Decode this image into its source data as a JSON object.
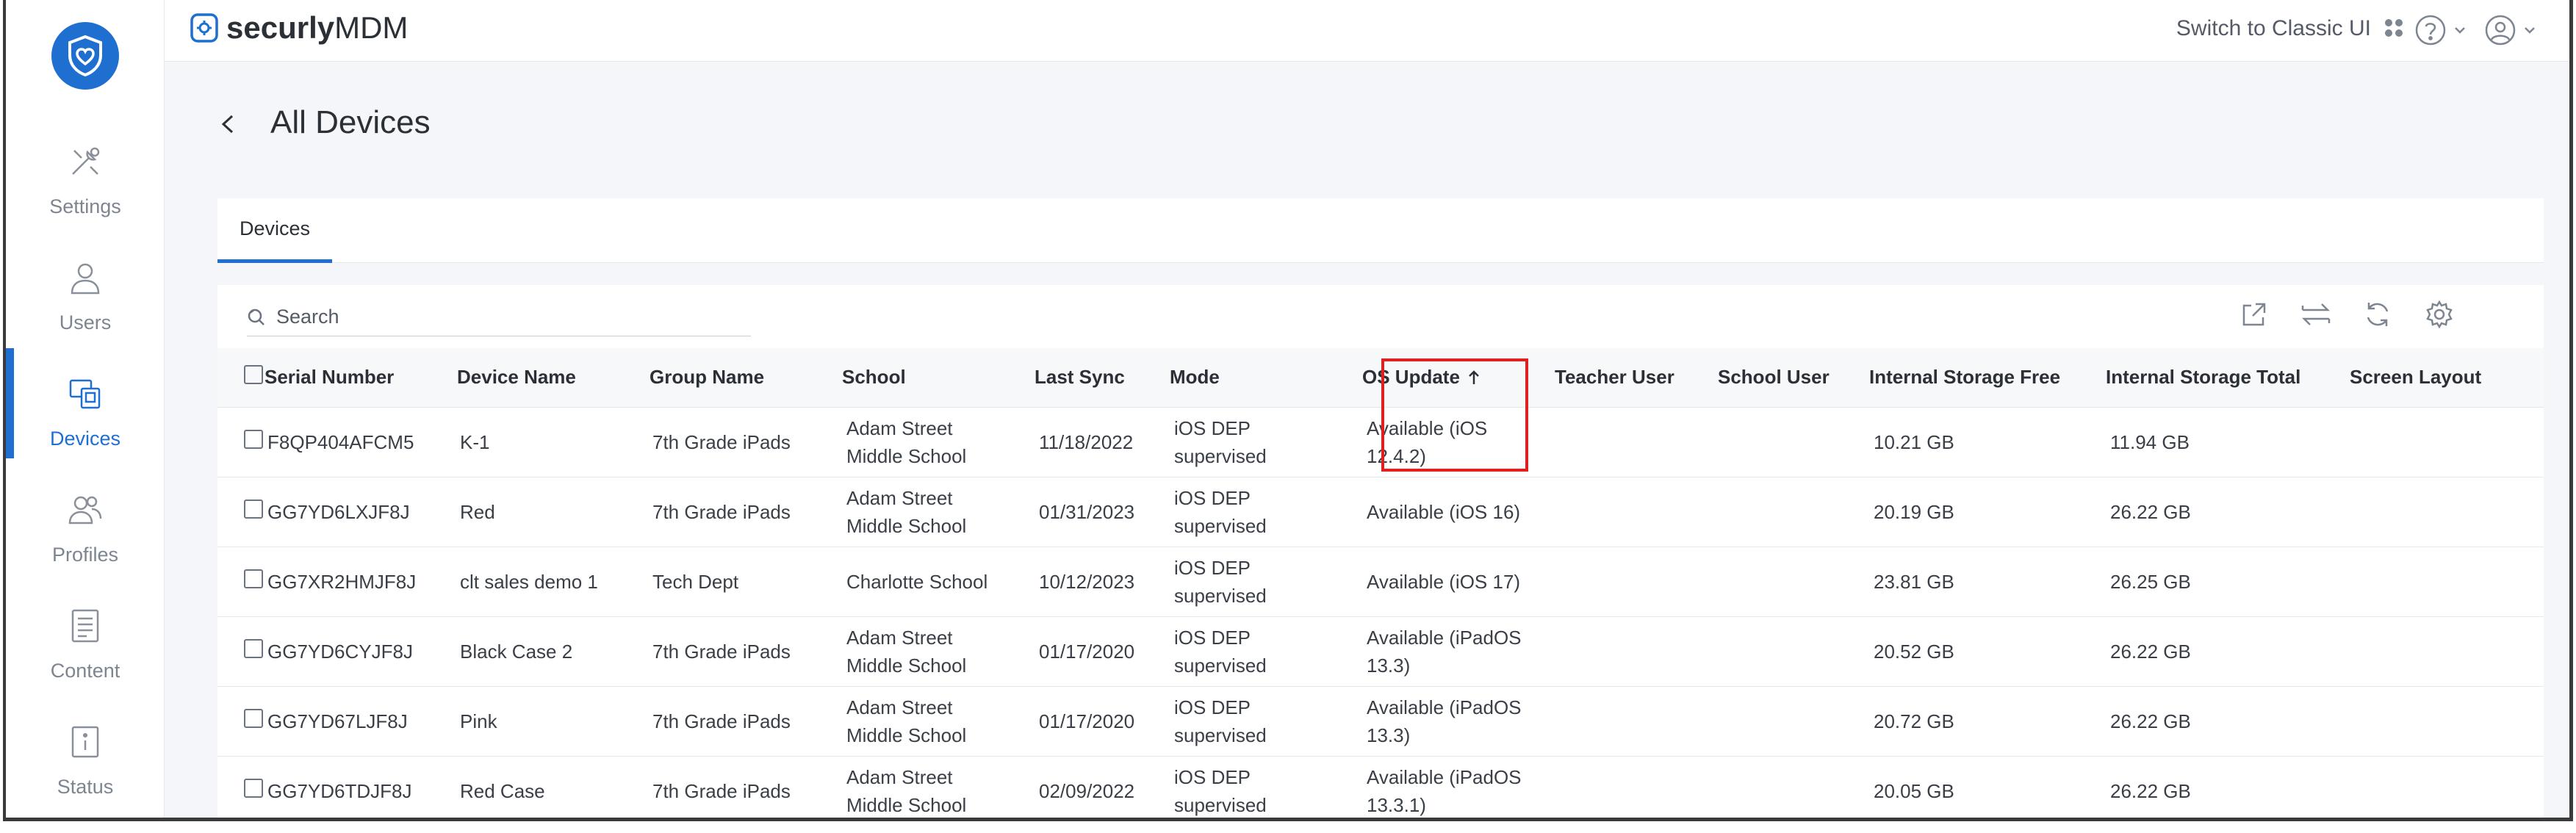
{
  "app": {
    "brand_prefix": "securly",
    "brand_suffix": "MDM"
  },
  "topbar": {
    "classic_link": "Switch to Classic UI"
  },
  "sidebar": {
    "items": [
      {
        "label": "Settings",
        "icon": "tools-icon"
      },
      {
        "label": "Users",
        "icon": "user-icon"
      },
      {
        "label": "Devices",
        "icon": "devices-icon",
        "active": true
      },
      {
        "label": "Profiles",
        "icon": "profiles-icon"
      },
      {
        "label": "Content",
        "icon": "content-icon"
      },
      {
        "label": "Status",
        "icon": "status-icon"
      }
    ]
  },
  "page": {
    "title": "All Devices"
  },
  "tabs": [
    {
      "label": "Devices"
    }
  ],
  "search": {
    "placeholder": "Search"
  },
  "table": {
    "columns": [
      "Serial Number",
      "Device Name",
      "Group Name",
      "School",
      "Last Sync",
      "Mode",
      "OS Update",
      "Teacher User",
      "School User",
      "Internal Storage Free",
      "Internal Storage Total",
      "Screen Layout"
    ],
    "sorted_column": "OS Update",
    "sort_direction": "ascending",
    "rows": [
      {
        "serial": "F8QP404AFCM5",
        "name": "K-1",
        "group": "7th Grade iPads",
        "school_l1": "Adam Street",
        "school_l2": "Middle School",
        "sync": "11/18/2022",
        "mode_l1": "iOS DEP",
        "mode_l2": "supervised",
        "os_l1": "Available (iOS",
        "os_l2": "12.4.2)",
        "teacher": "",
        "school_user": "",
        "free": "10.21 GB",
        "total": "11.94 GB",
        "layout": ""
      },
      {
        "serial": "GG7YD6LXJF8J",
        "name": "Red",
        "group": "7th Grade iPads",
        "school_l1": "Adam Street",
        "school_l2": "Middle School",
        "sync": "01/31/2023",
        "mode_l1": "iOS DEP",
        "mode_l2": "supervised",
        "os_l1": "Available (iOS 16)",
        "os_l2": "",
        "teacher": "",
        "school_user": "",
        "free": "20.19 GB",
        "total": "26.22 GB",
        "layout": ""
      },
      {
        "serial": "GG7XR2HMJF8J",
        "name": "clt sales demo 1",
        "group": "Tech Dept",
        "school_l1": "Charlotte School",
        "school_l2": "",
        "sync": "10/12/2023",
        "mode_l1": "iOS DEP",
        "mode_l2": "supervised",
        "os_l1": "Available (iOS 17)",
        "os_l2": "",
        "teacher": "",
        "school_user": "",
        "free": "23.81 GB",
        "total": "26.25 GB",
        "layout": ""
      },
      {
        "serial": "GG7YD6CYJF8J",
        "name": "Black Case 2",
        "group": "7th Grade iPads",
        "school_l1": "Adam Street",
        "school_l2": "Middle School",
        "sync": "01/17/2020",
        "mode_l1": "iOS DEP",
        "mode_l2": "supervised",
        "os_l1": "Available (iPadOS",
        "os_l2": "13.3)",
        "teacher": "",
        "school_user": "",
        "free": "20.52 GB",
        "total": "26.22 GB",
        "layout": ""
      },
      {
        "serial": "GG7YD67LJF8J",
        "name": "Pink",
        "group": "7th Grade iPads",
        "school_l1": "Adam Street",
        "school_l2": "Middle School",
        "sync": "01/17/2020",
        "mode_l1": "iOS DEP",
        "mode_l2": "supervised",
        "os_l1": "Available (iPadOS",
        "os_l2": "13.3)",
        "teacher": "",
        "school_user": "",
        "free": "20.72 GB",
        "total": "26.22 GB",
        "layout": ""
      },
      {
        "serial": "GG7YD6TDJF8J",
        "name": "Red Case",
        "group": "7th Grade iPads",
        "school_l1": "Adam Street",
        "school_l2": "Middle School",
        "sync": "02/09/2022",
        "mode_l1": "iOS DEP",
        "mode_l2": "supervised",
        "os_l1": "Available (iPadOS",
        "os_l2": "13.3.1)",
        "teacher": "",
        "school_user": "",
        "free": "20.05 GB",
        "total": "26.22 GB",
        "layout": ""
      }
    ]
  },
  "colors": {
    "accent": "#1f6fd1",
    "highlight": "#e02020",
    "background": "#f4f6f9"
  }
}
